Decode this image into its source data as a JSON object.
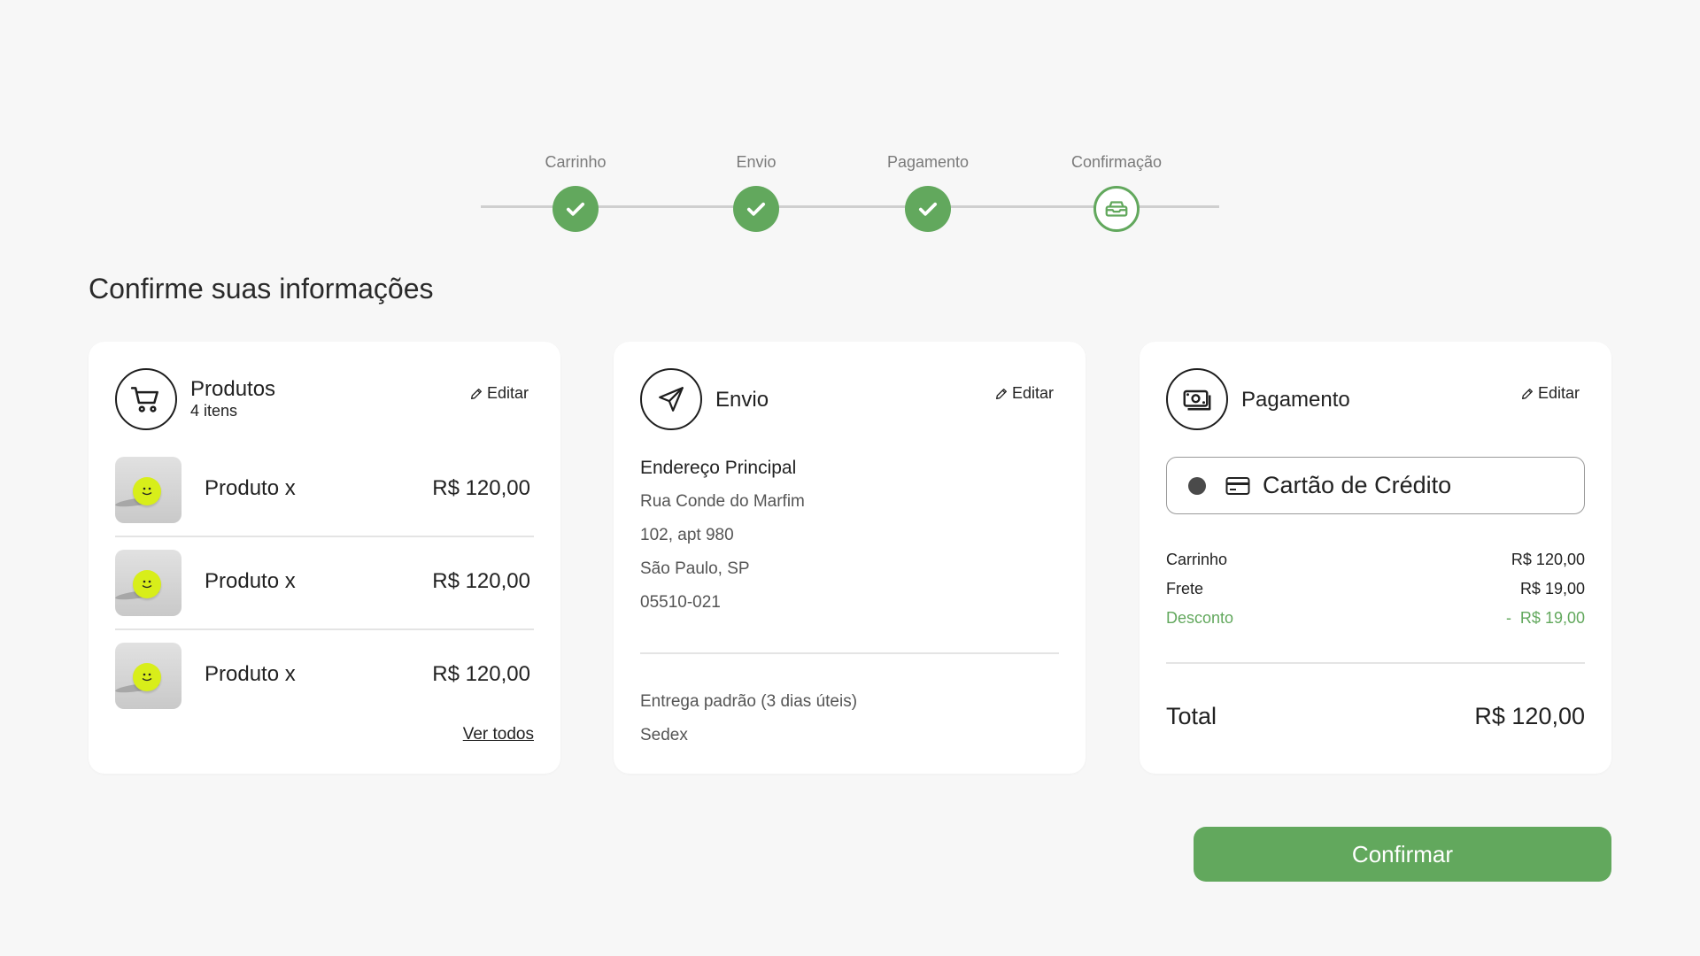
{
  "stepper": {
    "steps": [
      {
        "label": "Carrinho",
        "status": "done"
      },
      {
        "label": "Envio",
        "status": "done"
      },
      {
        "label": "Pagamento",
        "status": "done"
      },
      {
        "label": "Confirmação",
        "status": "current"
      }
    ],
    "accent": "#62a85d"
  },
  "title": "Confirme suas informações",
  "products": {
    "title": "Produtos",
    "count": "4 itens",
    "edit": "Editar",
    "items": [
      {
        "name": "Produto x",
        "price": "R$ 120,00"
      },
      {
        "name": "Produto x",
        "price": "R$ 120,00"
      },
      {
        "name": "Produto x",
        "price": "R$ 120,00"
      }
    ],
    "see_all": "Ver todos"
  },
  "shipping": {
    "title": "Envio",
    "edit": "Editar",
    "address_title": "Endereço Principal",
    "street": "Rua Conde do Marfim",
    "number": "102, apt 980",
    "city": "São Paulo, SP",
    "zip": "05510-021",
    "delivery": "Entrega padrão (3 dias úteis)",
    "carrier": "Sedex"
  },
  "payment": {
    "title": "Pagamento",
    "edit": "Editar",
    "method": "Cartão de Crédito",
    "summary": {
      "cart_label": "Carrinho",
      "cart_value": "R$ 120,00",
      "shipping_label": "Frete",
      "shipping_value": "R$ 19,00",
      "discount_label": "Desconto",
      "discount_value": "-  R$ 19,00"
    },
    "total_label": "Total",
    "total_value": "R$ 120,00"
  },
  "confirm_label": "Confirmar"
}
